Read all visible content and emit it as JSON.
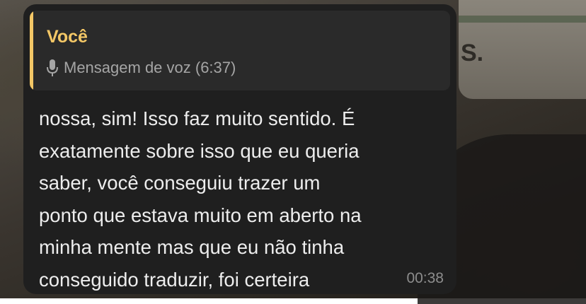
{
  "message": {
    "quote": {
      "author": "Você",
      "icon": "microphone-icon",
      "text": "Mensagem de voz (6:37)",
      "accent_color": "#f3c766"
    },
    "text": "nossa, sim! Isso faz muito sentido. É\nexatamente sobre isso que eu queria\nsaber, você conseguiu trazer um\nponto que estava muito em aberto na\nminha mente mas que eu não tinha\nconseguido traduzir, foi certeira",
    "time": "00:38"
  }
}
